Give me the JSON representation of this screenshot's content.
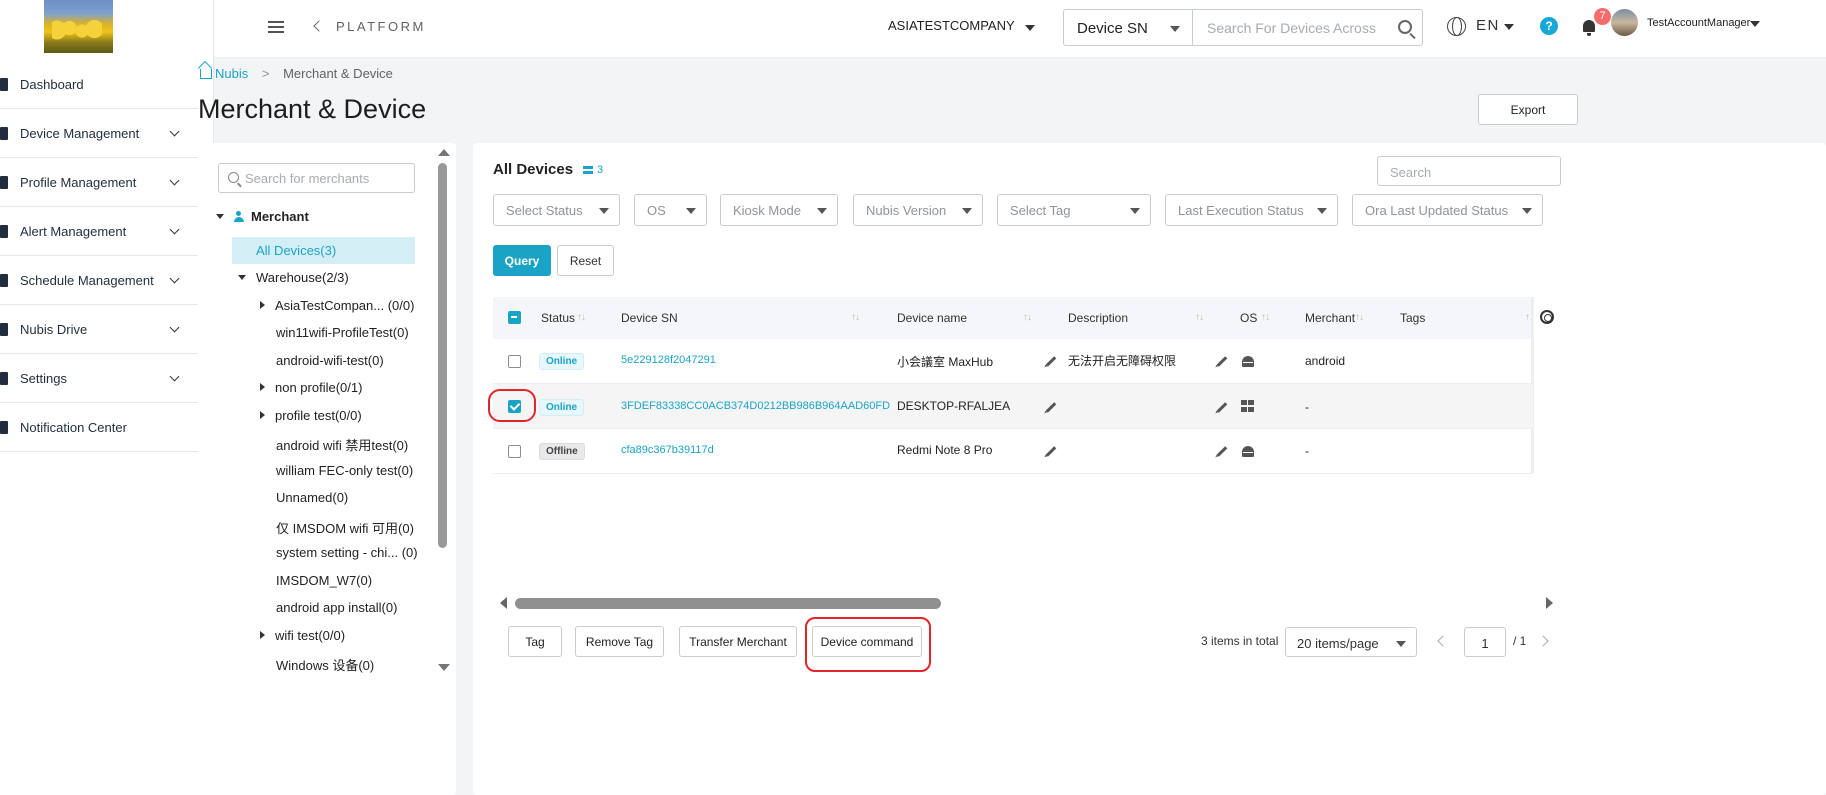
{
  "sidebar": {
    "items": [
      {
        "label": "Dashboard",
        "has_children": false
      },
      {
        "label": "Device Management",
        "has_children": true
      },
      {
        "label": "Profile Management",
        "has_children": true
      },
      {
        "label": "Alert Management",
        "has_children": true
      },
      {
        "label": "Schedule Management",
        "has_children": true
      },
      {
        "label": "Nubis Drive",
        "has_children": true
      },
      {
        "label": "Settings",
        "has_children": true
      },
      {
        "label": "Notification Center",
        "has_children": false
      }
    ]
  },
  "topbar": {
    "platform": "PLATFORM",
    "company": "ASIATESTCOMPANY",
    "search_scope": "Device SN",
    "search_placeholder": "Search For Devices Across",
    "language": "EN",
    "help": "?",
    "notification_count": "7",
    "username": "TestAccountManager"
  },
  "breadcrumb": {
    "home": "Nubis",
    "current": "Merchant & Device"
  },
  "page": {
    "title": "Merchant & Device",
    "export_label": "Export"
  },
  "merchants": {
    "search_placeholder": "Search for merchants",
    "root": "Merchant",
    "all_devices": "All Devices(3)",
    "nodes": [
      {
        "label": "Warehouse(2/3)",
        "level": 1,
        "toggle": "down"
      },
      {
        "label": "AsiaTestCompan... (0/0)",
        "level": 2,
        "toggle": "right"
      },
      {
        "label": "win11wifi-ProfileTest(0)",
        "level": 2,
        "toggle": "none"
      },
      {
        "label": "android-wifi-test(0)",
        "level": 2,
        "toggle": "none"
      },
      {
        "label": "non profile(0/1)",
        "level": 2,
        "toggle": "right"
      },
      {
        "label": "profile test(0/0)",
        "level": 2,
        "toggle": "right"
      },
      {
        "label": "android wifi 禁用test(0)",
        "level": 2,
        "toggle": "none"
      },
      {
        "label": "william FEC-only test(0)",
        "level": 2,
        "toggle": "none"
      },
      {
        "label": "Unnamed(0)",
        "level": 2,
        "toggle": "none"
      },
      {
        "label": "仅 IMSDOM wifi 可用(0)",
        "level": 2,
        "toggle": "none"
      },
      {
        "label": "system setting - chi... (0)",
        "level": 2,
        "toggle": "none"
      },
      {
        "label": "IMSDOM_W7(0)",
        "level": 2,
        "toggle": "none"
      },
      {
        "label": "android app install(0)",
        "level": 2,
        "toggle": "none"
      },
      {
        "label": "wifi test(0/0)",
        "level": 2,
        "toggle": "right"
      },
      {
        "label": "Windows 设备(0)",
        "level": 2,
        "toggle": "none"
      }
    ]
  },
  "devices": {
    "title": "All Devices",
    "count": "3",
    "search_placeholder": "Search",
    "filters": [
      "Select Status",
      "OS",
      "Kiosk Mode",
      "Nubis Version",
      "Select Tag",
      "Last Execution Status",
      "Ora Last Updated Status"
    ],
    "query_label": "Query",
    "reset_label": "Reset",
    "columns": [
      "Status",
      "Device SN",
      "Device name",
      "Description",
      "OS",
      "Merchant",
      "Tags"
    ],
    "rows": [
      {
        "checked": false,
        "status": "Online",
        "sn": "5e229128f2047291",
        "name": "小会議室 MaxHub",
        "description": "无法开启无障碍权限",
        "os": "android",
        "merchant": "android"
      },
      {
        "checked": true,
        "status": "Online",
        "sn": "3FDEF83338CC0ACB374D0212BB986B964AAD60FD",
        "name": "DESKTOP-RFALJEA",
        "description": "",
        "os": "windows",
        "merchant": "-"
      },
      {
        "checked": false,
        "status": "Offline",
        "sn": "cfa89c367b39117d",
        "name": "Redmi Note 8 Pro",
        "description": "",
        "os": "android",
        "merchant": "-"
      }
    ],
    "actions": [
      "Tag",
      "Remove Tag",
      "Transfer Merchant",
      "Device command"
    ],
    "total": "3 items in total",
    "page_size": "20 items/page",
    "page": "1",
    "page_total": "/ 1"
  },
  "colors": {
    "accent": "#1ba3c6",
    "highlight": "#e3242b",
    "badge": "#f56c6c"
  }
}
